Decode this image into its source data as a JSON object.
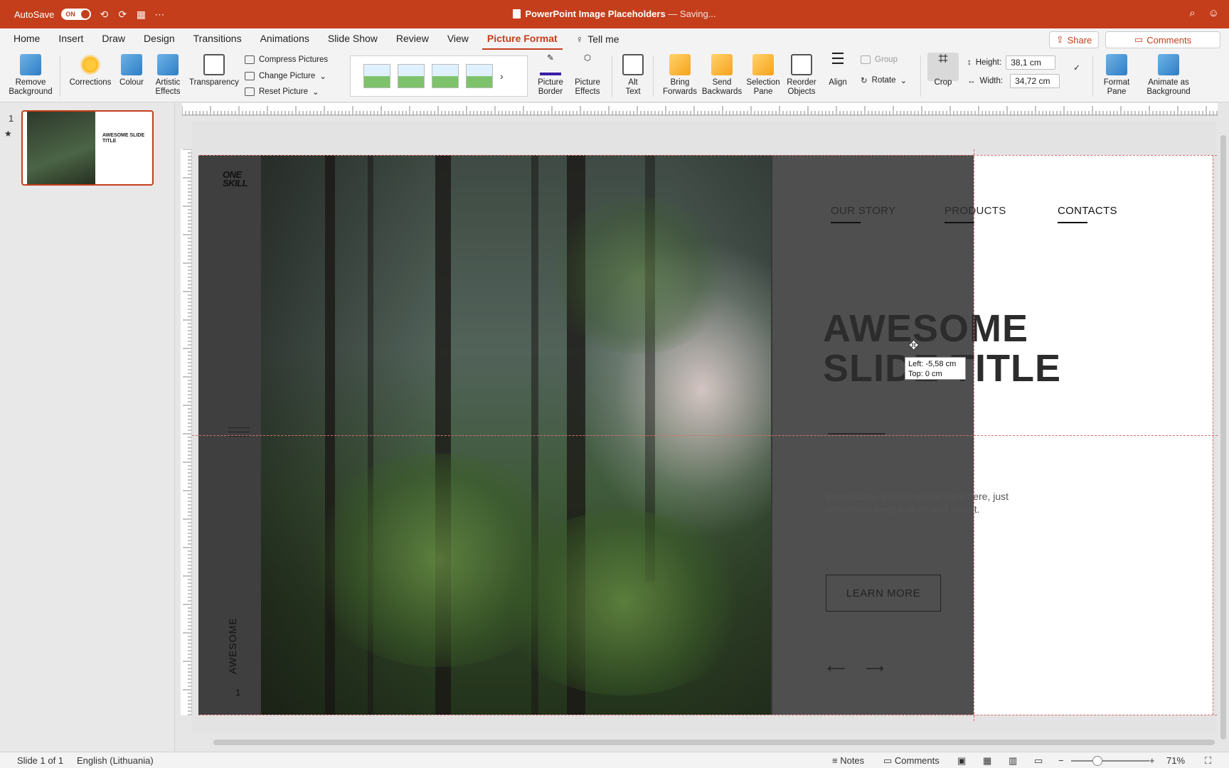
{
  "window": {
    "autosave_label": "AutoSave",
    "autosave_state": "ON",
    "doc_title": "PowerPoint Image Placeholders",
    "doc_status": " — Saving..."
  },
  "menu": {
    "tabs": [
      "Home",
      "Insert",
      "Draw",
      "Design",
      "Transitions",
      "Animations",
      "Slide Show",
      "Review",
      "View",
      "Picture Format"
    ],
    "tell_me": "Tell me",
    "share": "Share",
    "comments": "Comments"
  },
  "ribbon": {
    "remove_background": [
      "Remove",
      "Background"
    ],
    "corrections": "Corrections",
    "colour": "Colour",
    "artistic_effects": [
      "Artistic",
      "Effects"
    ],
    "transparency": "Transparency",
    "compress_pictures": "Compress Pictures",
    "change_picture": "Change Picture",
    "reset_picture": "Reset Picture",
    "picture_border": [
      "Picture",
      "Border"
    ],
    "picture_effects": [
      "Picture",
      "Effects"
    ],
    "alt_text": [
      "Alt",
      "Text"
    ],
    "bring_forwards": [
      "Bring",
      "Forwards"
    ],
    "send_backwards": [
      "Send",
      "Backwards"
    ],
    "selection_pane": [
      "Selection",
      "Pane"
    ],
    "reorder_objects": [
      "Reorder",
      "Objects"
    ],
    "align": "Align",
    "group": "Group",
    "rotate": "Rotate",
    "crop": "Crop",
    "height_label": "Height:",
    "height_value": "38,1 cm",
    "width_label": "Width:",
    "width_value": "34,72 cm",
    "format_pane": [
      "Format",
      "Pane"
    ],
    "animate_as_background": [
      "Animate as",
      "Background"
    ]
  },
  "thumbnails": {
    "slide_number": "1",
    "thumb_title": "AWESOME SLIDE TITLE"
  },
  "slide": {
    "logo_line1": "ONE",
    "logo_line2": "SKILL",
    "nav": [
      "OUR STORY",
      "PRODUCTS",
      "CONTACTS"
    ],
    "title_line1": "AWESOME",
    "title_line2": "SLIDE TITLE",
    "body": "Insert some awesome text right here, just remember keep it short and sweet.",
    "button": "LEARN MORE",
    "arrow_left": "⟵",
    "arrow_right": "⟶",
    "vertical_word": "AWESOME",
    "page_number": "1"
  },
  "tooltip": {
    "left": "Left: -5,58 cm",
    "top": "Top: 0 cm"
  },
  "status": {
    "slide_count": "Slide 1 of 1",
    "language": "English (Lithuania)",
    "notes": "Notes",
    "comments": "Comments",
    "zoom": "71%"
  }
}
